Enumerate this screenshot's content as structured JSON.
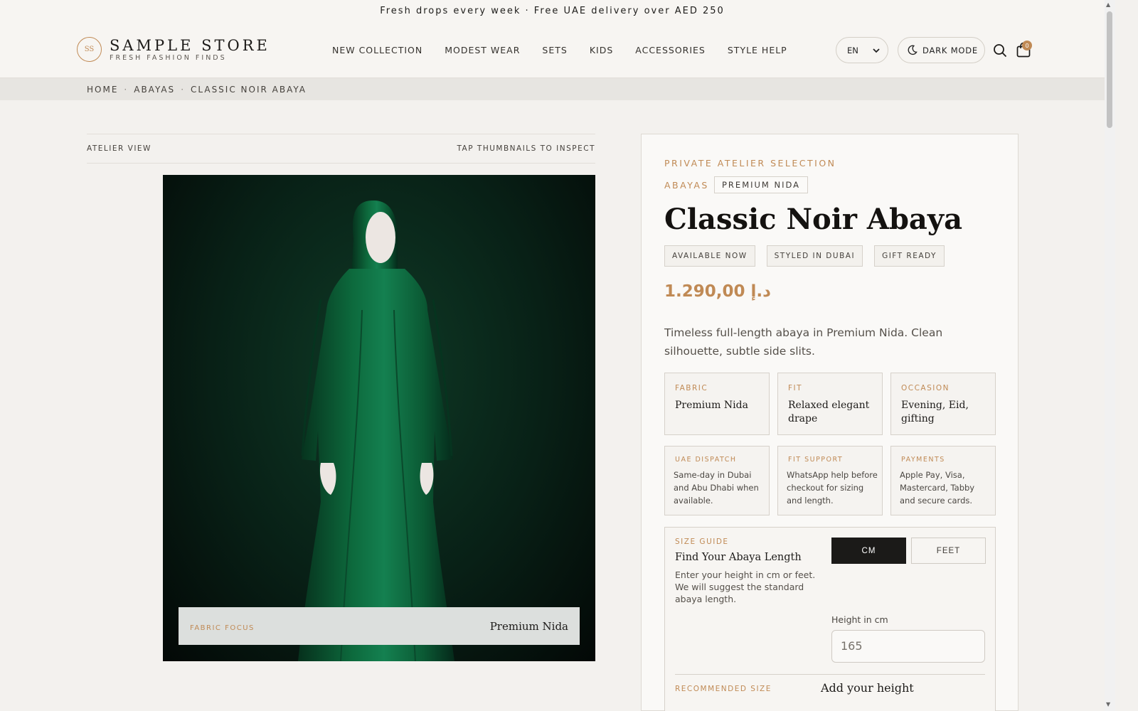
{
  "announcement": "Fresh drops every week · Free UAE delivery over AED 250",
  "brand": {
    "badge": "SS",
    "name": "SAMPLE STORE",
    "tagline": "FRESH FASHION FINDS"
  },
  "nav": [
    "NEW COLLECTION",
    "MODEST WEAR",
    "SETS",
    "KIDS",
    "ACCESSORIES",
    "STYLE HELP"
  ],
  "header": {
    "language": "EN",
    "dark_mode_label": "DARK MODE",
    "cart_count": "0"
  },
  "breadcrumb": [
    "HOME",
    "ABAYAS",
    "CLASSIC NOIR ABAYA"
  ],
  "gallery": {
    "left_label": "ATELIER VIEW",
    "right_label": "TAP THUMBNAILS TO INSPECT",
    "focus_label": "FABRIC FOCUS",
    "focus_value": "Premium Nida"
  },
  "product": {
    "eyebrow": "PRIVATE ATELIER SELECTION",
    "category": "ABAYAS",
    "fabric_chip": "PREMIUM NIDA",
    "title": "Classic Noir Abaya",
    "tags": [
      "AVAILABLE NOW",
      "STYLED IN DUBAI",
      "GIFT READY"
    ],
    "price": "د.إ 1.290,00",
    "description": "Timeless full-length abaya in Premium Nida. Clean silhouette, subtle side slits.",
    "specs": [
      {
        "label": "FABRIC",
        "value": "Premium Nida"
      },
      {
        "label": "FIT",
        "value": "Relaxed elegant drape"
      },
      {
        "label": "OCCASION",
        "value": "Evening, Eid, gifting"
      }
    ],
    "services": [
      {
        "label": "UAE DISPATCH",
        "value": "Same-day in Dubai and Abu Dhabi when available."
      },
      {
        "label": "FIT SUPPORT",
        "value": "WhatsApp help before checkout for sizing and length."
      },
      {
        "label": "PAYMENTS",
        "value": "Apple Pay, Visa, Mastercard, Tabby and secure cards."
      }
    ]
  },
  "size_guide": {
    "label": "SIZE GUIDE",
    "title": "Find Your Abaya Length",
    "description": "Enter your height in cm or feet. We will suggest the standard abaya length.",
    "unit_cm": "CM",
    "unit_feet": "FEET",
    "height_label": "Height in cm",
    "height_placeholder": "165",
    "recommended_label": "RECOMMENDED SIZE",
    "recommended_value": "Add your height"
  },
  "colors": {
    "accent": "#c08a55",
    "dress": "#0e6a3e",
    "background": "#f3f1ee"
  }
}
